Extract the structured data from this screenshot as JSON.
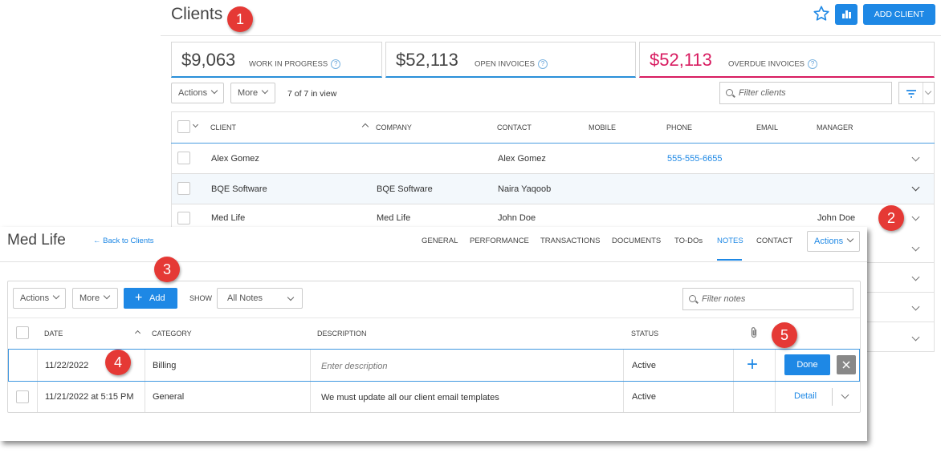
{
  "header": {
    "title": "Clients",
    "add_client_label": "ADD CLIENT"
  },
  "stats": [
    {
      "value": "$9,063",
      "label": "WORK IN PROGRESS",
      "help": "?"
    },
    {
      "value": "$52,113",
      "label": "OPEN INVOICES",
      "help": "?"
    },
    {
      "value": "$52,113",
      "label": "OVERDUE INVOICES",
      "help": "?",
      "color": "#d81b60"
    }
  ],
  "toolbar": {
    "actions_label": "Actions",
    "more_label": "More",
    "view_count": "7 of 7 in view",
    "filter_placeholder": "Filter clients"
  },
  "clients_table": {
    "headers": [
      "CLIENT",
      "COMPANY",
      "CONTACT",
      "MOBILE",
      "PHONE",
      "EMAIL",
      "MANAGER"
    ],
    "rows": [
      {
        "client": "Alex Gomez",
        "company": "",
        "contact": "Alex Gomez",
        "mobile": "",
        "phone": "555-555-6655",
        "email": "",
        "manager": ""
      },
      {
        "client": "BQE Software",
        "company": "BQE Software",
        "contact": "Naira Yaqoob",
        "mobile": "",
        "phone": "",
        "email": "",
        "manager": ""
      },
      {
        "client": "Med Life",
        "company": "Med Life",
        "contact": "John Doe",
        "mobile": "",
        "phone": "",
        "email": "",
        "manager": "John Doe"
      }
    ]
  },
  "detail": {
    "title": "Med Life",
    "back_label": "← Back to Clients",
    "tabs": [
      "GENERAL",
      "PERFORMANCE",
      "TRANSACTIONS",
      "DOCUMENTS",
      "TO-DOs",
      "NOTES",
      "CONTACT"
    ],
    "active_tab": "NOTES",
    "actions_label": "Actions",
    "notes_toolbar": {
      "actions_label": "Actions",
      "more_label": "More",
      "add_label": "Add",
      "show_label": "SHOW",
      "show_value": "All Notes",
      "filter_placeholder": "Filter notes"
    },
    "notes_headers": [
      "DATE",
      "CATEGORY",
      "DESCRIPTION",
      "STATUS"
    ],
    "edit_row": {
      "date": "11/22/2022",
      "category": "Billing",
      "description_placeholder": "Enter description",
      "status": "Active",
      "done_label": "Done"
    },
    "note_rows": [
      {
        "date": "11/21/2022 at 5:15 PM",
        "category": "General",
        "description": "We must update all our client email templates",
        "status": "Active",
        "detail_label": "Detail"
      }
    ]
  },
  "callouts": [
    "1",
    "2",
    "3",
    "4",
    "5"
  ],
  "colors": {
    "accent": "#1e88e5",
    "callout": "#e53935",
    "overdue": "#d81b60"
  }
}
